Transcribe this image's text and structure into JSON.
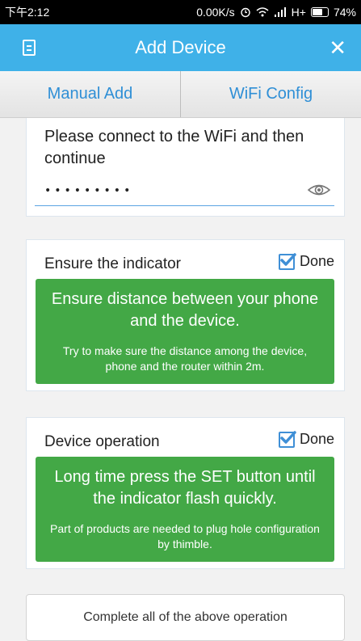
{
  "status_bar": {
    "time": "下午2:12",
    "speed": "0.00K/s",
    "network": "H+",
    "battery": "74%",
    "battery_level": 0.74
  },
  "app_bar": {
    "title": "Add Device",
    "menu_icon": "list-icon",
    "close_icon": "close-icon"
  },
  "tabs": [
    {
      "label": "Manual Add"
    },
    {
      "label": "WiFi Config"
    }
  ],
  "wifi": {
    "prompt": "Please connect to the WiFi and then continue",
    "password_masked": "•••••••••",
    "eye_icon": "eye-icon"
  },
  "sections": [
    {
      "title": "Ensure the indicator",
      "done_label": "Done",
      "done_checked": true,
      "main_text": "Ensure distance between your phone and the device.",
      "sub_text": "Try to make sure the distance among the device, phone and the router within 2m."
    },
    {
      "title": "Device operation",
      "done_label": "Done",
      "done_checked": true,
      "main_text": "Long time press the SET button until the indicator flash quickly.",
      "sub_text": "Part of products are needed to plug hole configuration by thimble."
    }
  ],
  "complete_button": "Complete all of the above operation",
  "colors": {
    "app_bar": "#3fb1e8",
    "tab_text": "#2f8fd6",
    "green_box": "#43a846",
    "checkbox": "#3f8fd6"
  }
}
